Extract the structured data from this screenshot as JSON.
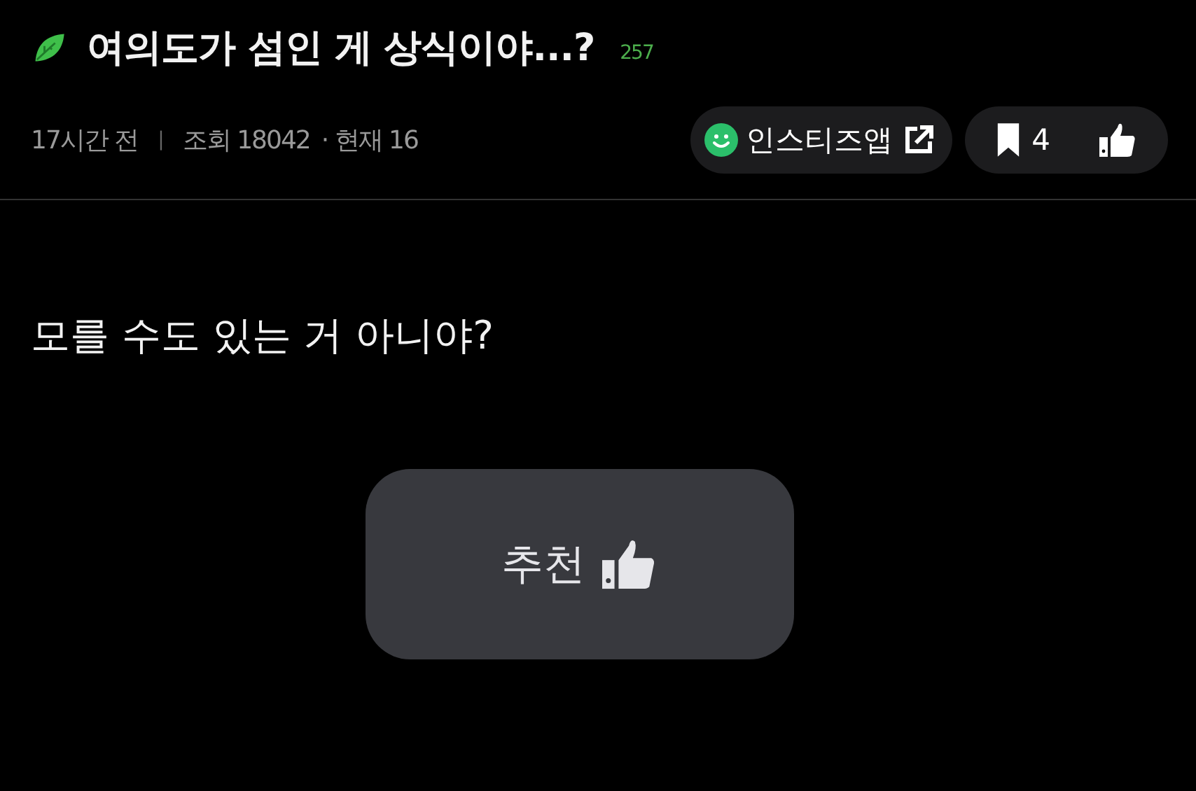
{
  "post": {
    "title": "여의도가 섬인 게 상식이야...?",
    "comment_count": "257"
  },
  "meta": {
    "time": "17시간 전",
    "separator": "|",
    "views": "조회 18042",
    "current": "· 현재 16"
  },
  "app_link": {
    "label": "인스티즈앱"
  },
  "bookmark": {
    "count": "4"
  },
  "body": "모를 수도 있는 거 아니야?",
  "recommend_button": {
    "label": "추천"
  }
}
